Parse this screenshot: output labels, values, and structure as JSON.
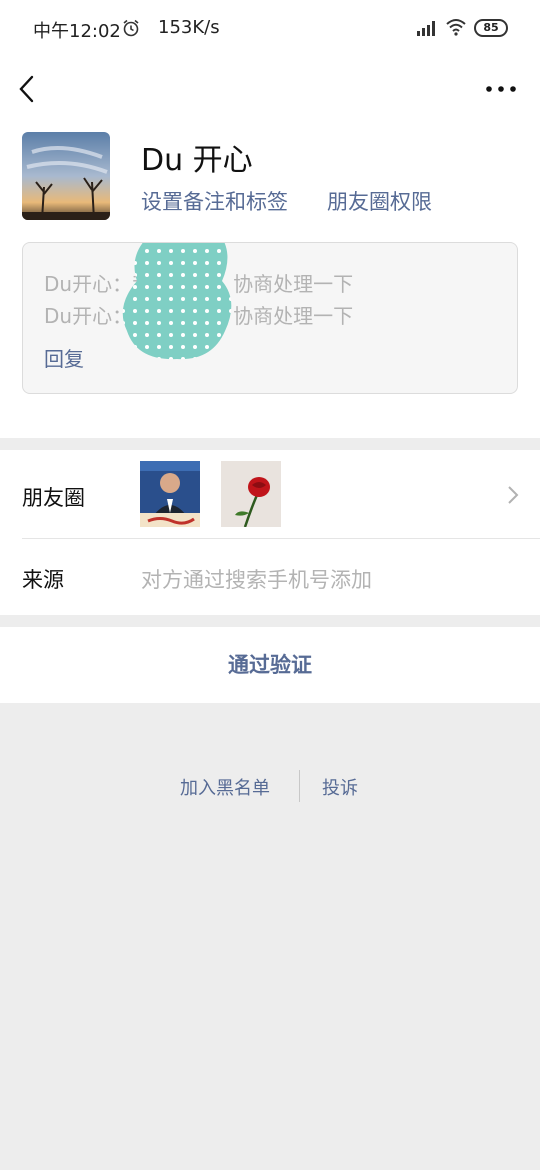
{
  "status_bar": {
    "time": "中午12:02",
    "speed": "153K/s",
    "battery": "85",
    "icons": [
      "alarm-icon",
      "signal-icon",
      "wifi-icon",
      "battery-icon"
    ]
  },
  "nav": {
    "back_icon": "back-arrow-icon",
    "more_icon": "more-dots-icon"
  },
  "profile": {
    "name": "Du 开心",
    "set_remark_label": "设置备注和标签",
    "moments_permission_label": "朋友圈权限"
  },
  "message": {
    "line1": "Du开心：我是cool，协商处理一下",
    "line2": "Du开心：我是cool，协商处理一下",
    "reply_label": "回复"
  },
  "moments": {
    "label": "朋友圈",
    "chevron_icon": "chevron-right-icon"
  },
  "source": {
    "label": "来源",
    "value": "对方通过搜索手机号添加"
  },
  "verify_button": "通过验证",
  "footer": {
    "blacklist_label": "加入黑名单",
    "report_label": "投诉"
  },
  "colors": {
    "link": "#576b95",
    "background": "#ededed",
    "muted_text": "#b3b3b3"
  }
}
